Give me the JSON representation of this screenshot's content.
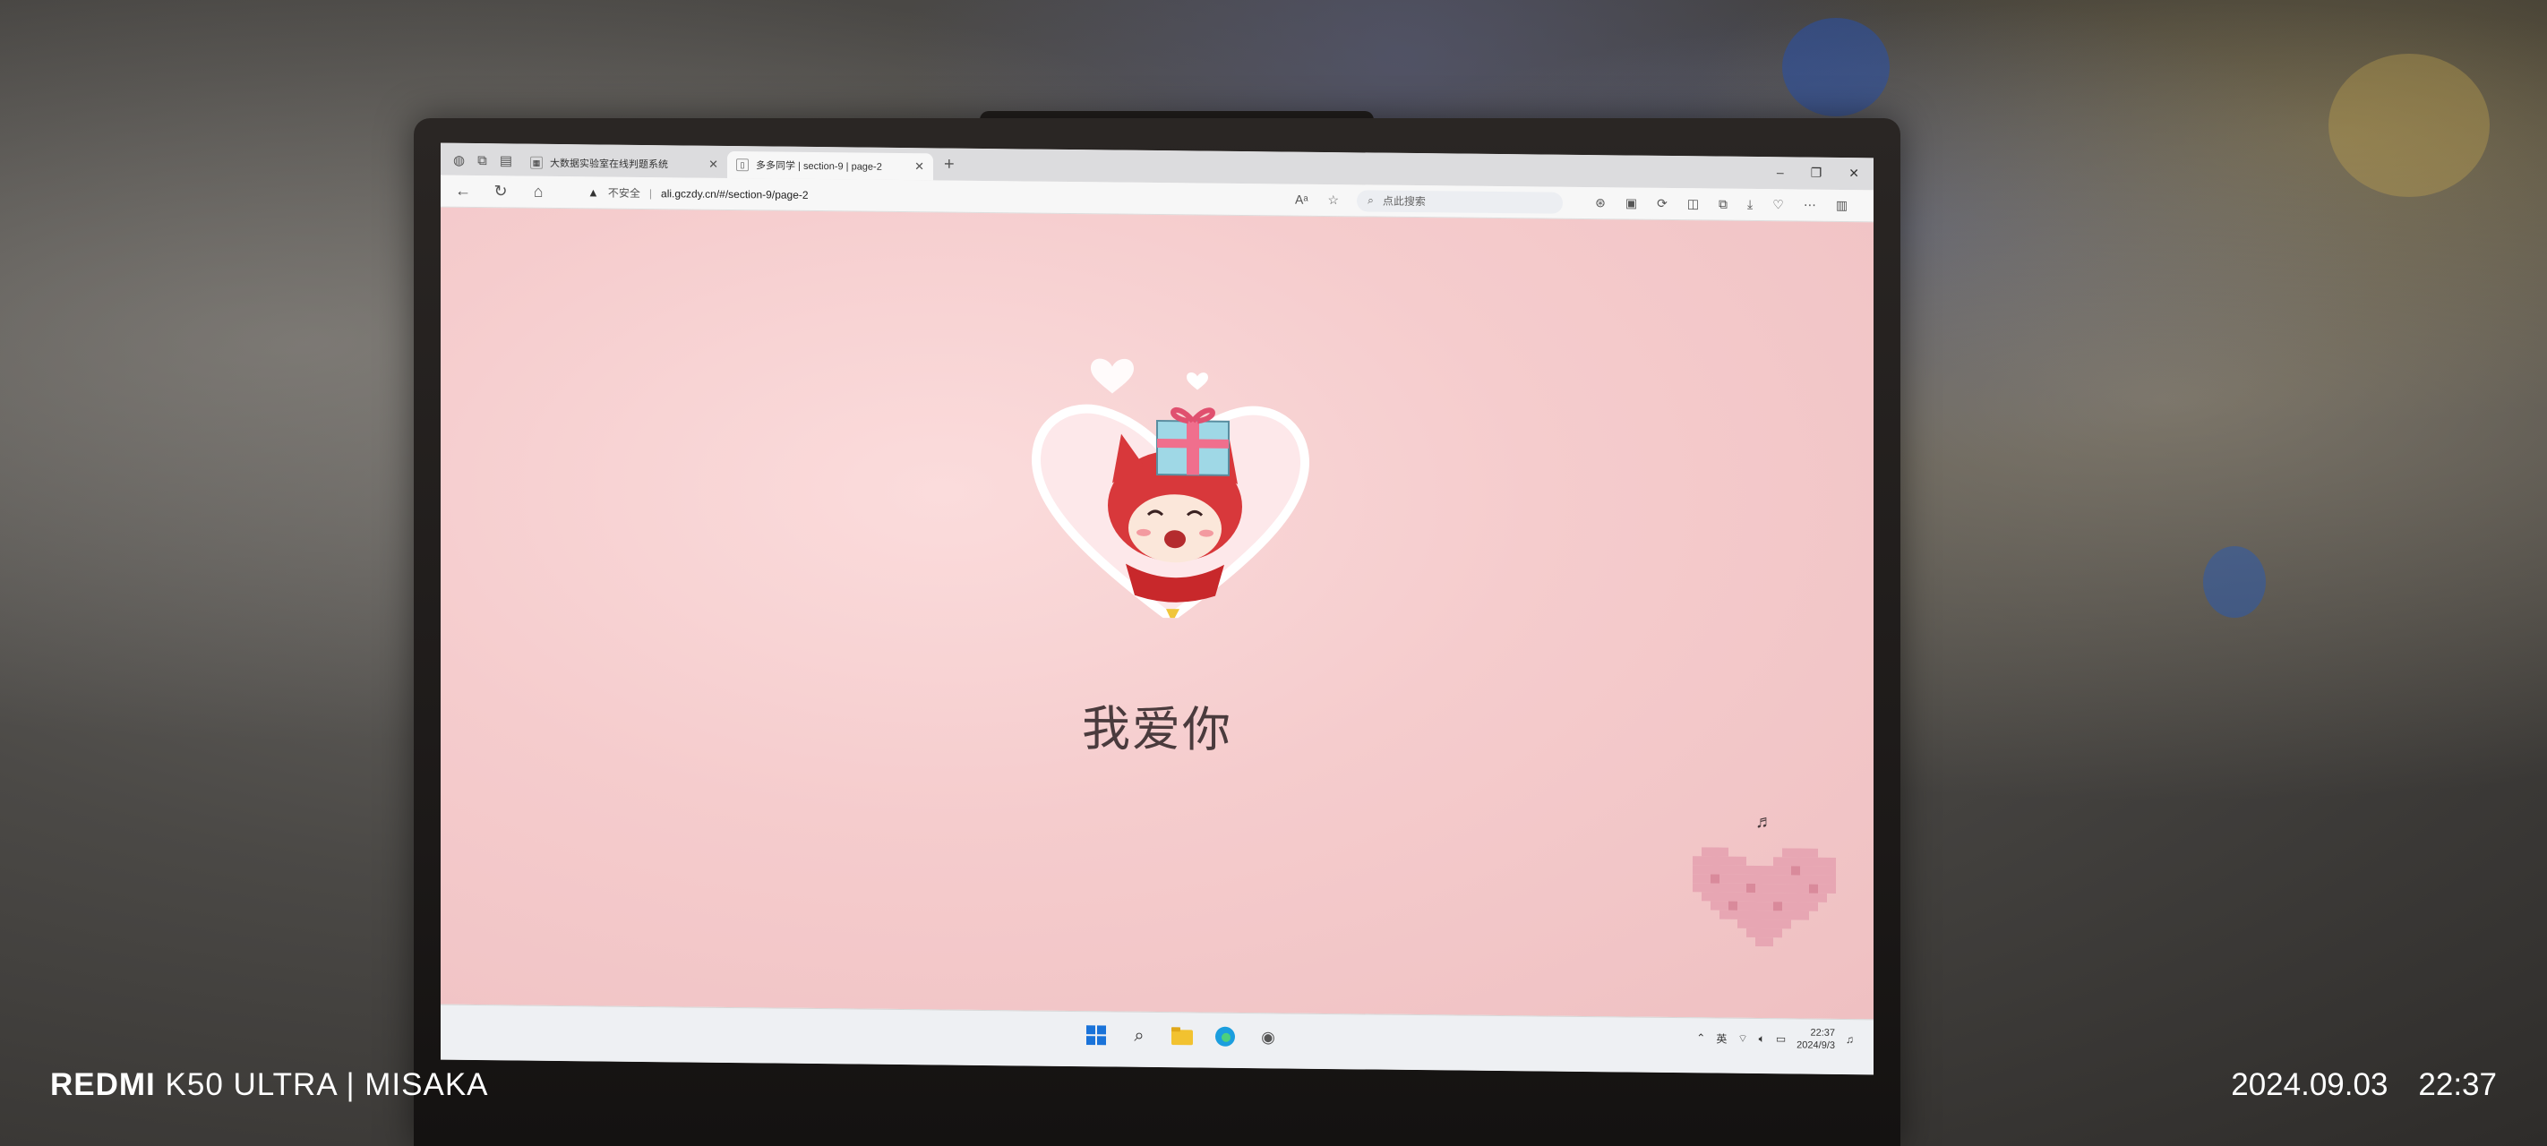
{
  "browser": {
    "tabs": [
      {
        "title": "大数据实验室在线判题系统",
        "active": false
      },
      {
        "title": "多多同学 | section-9 | page-2",
        "active": true
      }
    ],
    "new_tab_label": "+",
    "window_controls": {
      "minimize": "–",
      "maximize": "❐",
      "close": "✕"
    },
    "address": {
      "security_text": "不安全",
      "separator": "|",
      "url": "ali.gczdy.cn/#/section-9/page-2"
    },
    "search_placeholder": "点此搜索"
  },
  "page": {
    "message": "我爱你",
    "music_note": "♬",
    "colors": {
      "background": "#f5cccd",
      "text": "#4a3b3d",
      "pixel_heart": "#e7a6b3"
    }
  },
  "taskbar": {
    "tray_ime": "英",
    "time": "22:37",
    "date": "2024/9/3"
  },
  "watermark": {
    "brand": "REDMI",
    "model": "K50 ULTRA | MISAKA",
    "date": "2024.09.03",
    "time": "22:37"
  }
}
